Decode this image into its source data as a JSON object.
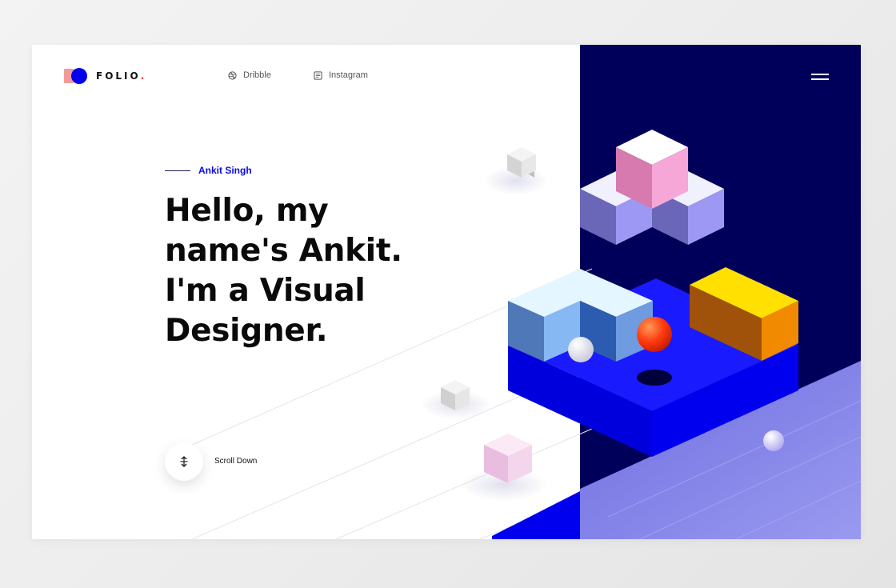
{
  "brand": {
    "name": "FOLIO",
    "dot": "."
  },
  "nav": [
    {
      "label": "Dribble",
      "icon": "dribbble-icon"
    },
    {
      "label": "Instagram",
      "icon": "instagram-icon"
    }
  ],
  "menu": {
    "icon": "hamburger-menu-icon"
  },
  "hero": {
    "author": "Ankit Singh",
    "headline_lines": [
      "Hello, my",
      "name's Ankit.",
      "I'm a Visual",
      "Designer."
    ]
  },
  "scroll": {
    "label": "Scroll Down",
    "icon": "scroll-arrows-icon"
  },
  "colors": {
    "accent_blue": "#0000ee",
    "navy_panel": "#00005a",
    "brand_dot": "#ff3300",
    "logo_pink": "#f29a9a"
  }
}
